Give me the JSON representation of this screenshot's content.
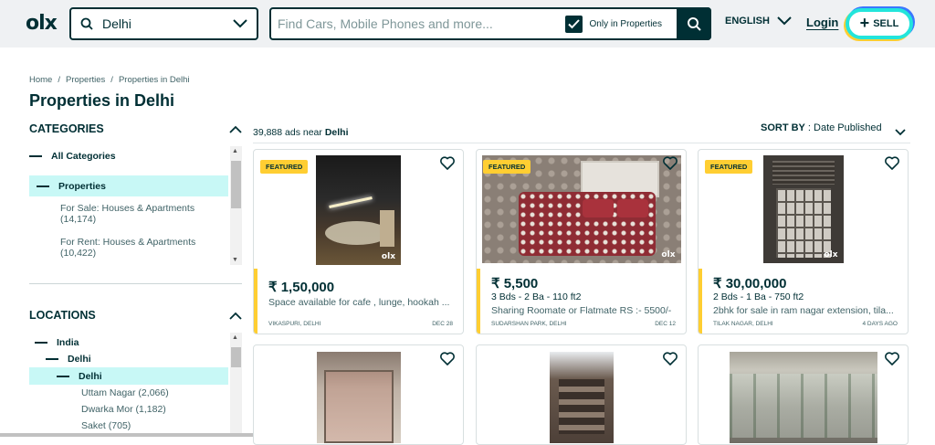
{
  "header": {
    "logo": "olx",
    "location": "Delhi",
    "search_placeholder": "Find Cars, Mobile Phones and more...",
    "checkbox_label": "Only in Properties",
    "language": "ENGLISH",
    "login": "Login",
    "sell": "SELL"
  },
  "breadcrumb": [
    "Home",
    "/",
    "Properties",
    "/",
    "Properties in Delhi"
  ],
  "page_title": "Properties in Delhi",
  "categories": {
    "title": "CATEGORIES",
    "all": "All Categories",
    "selected": "Properties",
    "items": [
      {
        "name": "For Sale: Houses & Apartments",
        "count": "(14,174)"
      },
      {
        "name": "For Rent: Houses & Apartments",
        "count": "(10,422)"
      }
    ]
  },
  "locations": {
    "title": "LOCATIONS",
    "country": "India",
    "state": "Delhi",
    "city": "Delhi",
    "items": [
      "Uttam Nagar (2,066)",
      "Dwarka Mor (1,182)",
      "Saket (705)"
    ]
  },
  "results": {
    "count": "39,888 ads near",
    "place": "Delhi",
    "sort_label": "SORT BY",
    "sort_value": ": Date Published"
  },
  "listings": [
    {
      "featured": "FEATURED",
      "price": "₹ 1,50,000",
      "meta": "",
      "desc": "Space available for cafe , lunge, hookah ...",
      "place": "VIKASPURI, DELHI",
      "date": "DEC 28"
    },
    {
      "featured": "FEATURED",
      "price": "₹ 5,500",
      "meta": "3 Bds - 2 Ba - 110 ft2",
      "desc": "Sharing Roomate or Flatmate RS :- 5500/-",
      "place": "SUDARSHAN PARK, DELHI",
      "date": "DEC 12"
    },
    {
      "featured": "FEATURED",
      "price": "₹ 30,00,000",
      "meta": "2 Bds - 1 Ba - 750 ft2",
      "desc": "2bhk for sale in ram nagar extension, tila...",
      "place": "TILAK NAGAR, DELHI",
      "date": "4 DAYS AGO"
    }
  ],
  "watermark": "olx",
  "colors": {
    "brand": "#002f34",
    "accent": "#ffce32",
    "selected_bg": "#c8f8f6"
  }
}
